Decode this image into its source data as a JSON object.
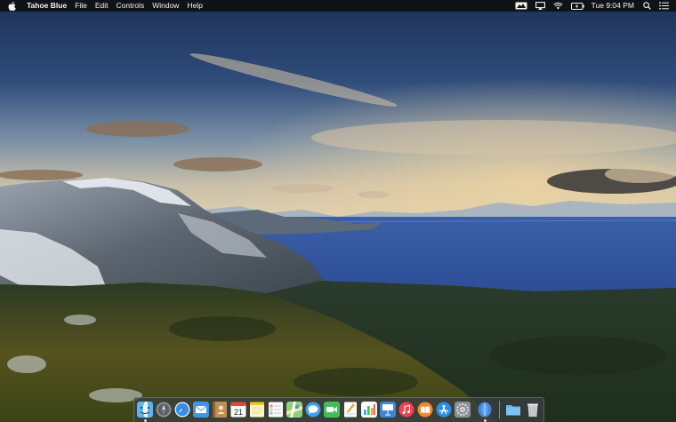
{
  "menubar": {
    "app_name": "Tahoe Blue",
    "menus": [
      "File",
      "Edit",
      "Controls",
      "Window",
      "Help"
    ],
    "clock": "Tue 9:04 PM",
    "status_icons": [
      "screen-sharing-icon",
      "airplay-icon",
      "wifi-icon",
      "battery-charging-icon",
      "spotlight-search-icon",
      "notification-center-icon"
    ]
  },
  "dock": {
    "apps": [
      {
        "name": "finder-icon",
        "running": true
      },
      {
        "name": "launchpad-icon",
        "running": false
      },
      {
        "name": "safari-icon",
        "running": false
      },
      {
        "name": "mail-icon",
        "running": false
      },
      {
        "name": "contacts-icon",
        "running": false
      },
      {
        "name": "calendar-icon",
        "running": false,
        "day": "21"
      },
      {
        "name": "notes-icon",
        "running": false
      },
      {
        "name": "reminders-icon",
        "running": false
      },
      {
        "name": "maps-icon",
        "running": false
      },
      {
        "name": "messages-icon",
        "running": false
      },
      {
        "name": "facetime-icon",
        "running": false
      },
      {
        "name": "pages-icon",
        "running": false
      },
      {
        "name": "numbers-icon",
        "running": false
      },
      {
        "name": "keynote-icon",
        "running": false
      },
      {
        "name": "itunes-icon",
        "running": false
      },
      {
        "name": "ibooks-icon",
        "running": false
      },
      {
        "name": "app-store-icon",
        "running": false
      },
      {
        "name": "system-preferences-icon",
        "running": false
      },
      {
        "name": "tahoe-blue-icon",
        "running": true
      }
    ],
    "extras": [
      {
        "name": "downloads-folder-icon"
      },
      {
        "name": "trash-icon"
      }
    ]
  }
}
